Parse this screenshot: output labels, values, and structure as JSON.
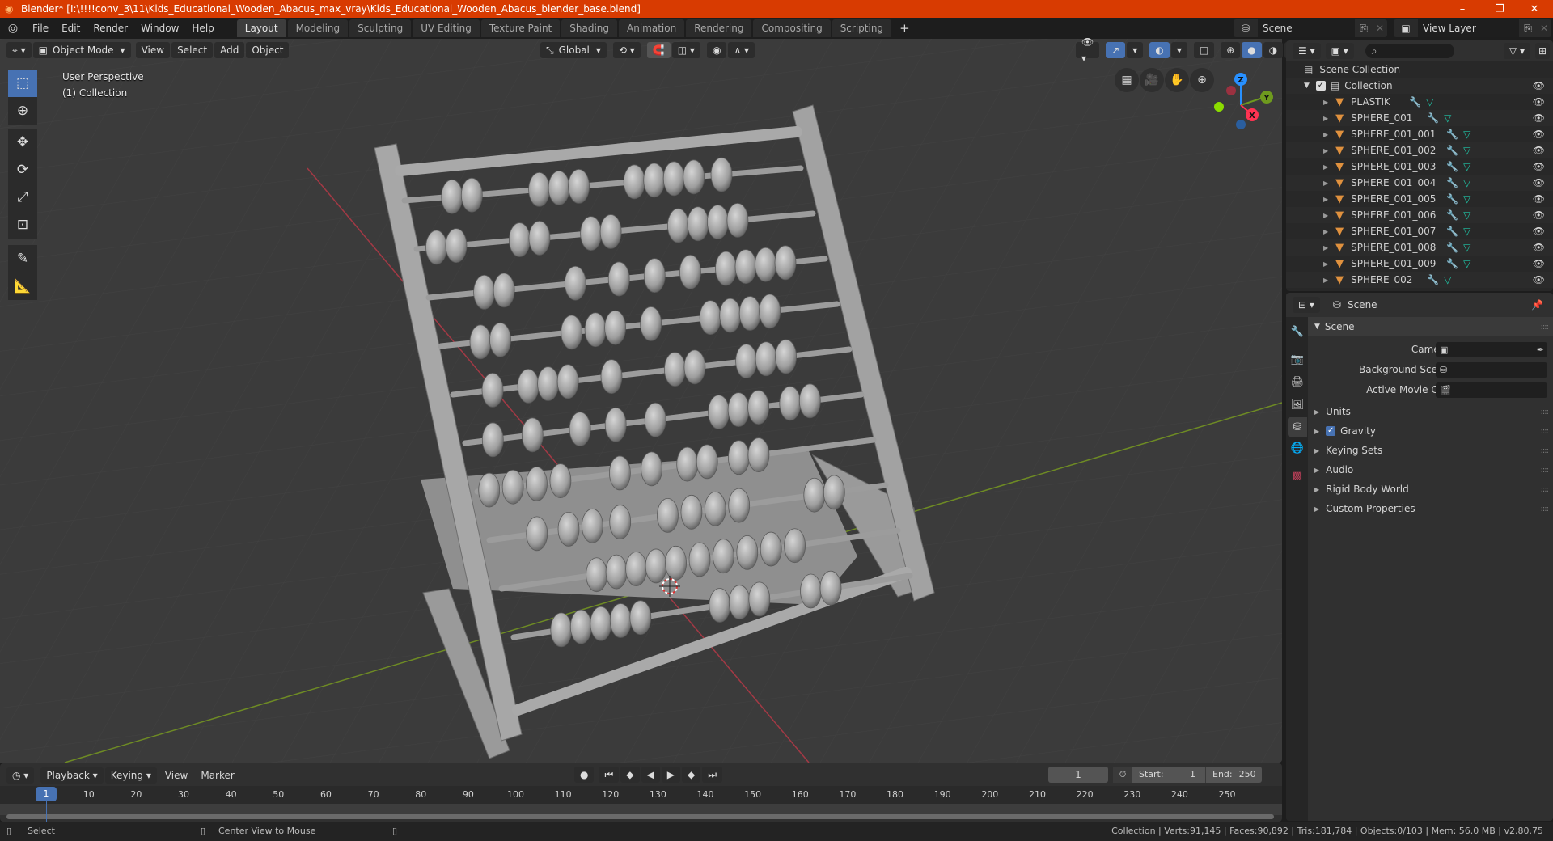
{
  "window": {
    "title": "Blender* [I:\\!!!!conv_3\\11\\Kids_Educational_Wooden_Abacus_max_vray\\Kids_Educational_Wooden_Abacus_blender_base.blend]",
    "controls": {
      "minimize": "–",
      "maximize": "❐",
      "close": "✕"
    }
  },
  "menubar": {
    "items": [
      "File",
      "Edit",
      "Render",
      "Window",
      "Help"
    ],
    "workspaces": [
      "Layout",
      "Modeling",
      "Sculpting",
      "UV Editing",
      "Texture Paint",
      "Shading",
      "Animation",
      "Rendering",
      "Compositing",
      "Scripting"
    ],
    "active_workspace": "Layout",
    "add_workspace": "+",
    "scene": "Scene",
    "view_layer": "View Layer"
  },
  "viewport": {
    "mode": "Object Mode",
    "menus": [
      "View",
      "Select",
      "Add",
      "Object"
    ],
    "orientation": "Global",
    "overlay_text": [
      "User Perspective",
      "(1) Collection"
    ],
    "gizmo_axes": {
      "z": "Z",
      "y": "Y",
      "x": "X"
    },
    "axis_colors": {
      "x": "#ff3352",
      "y": "#8bdc00",
      "z": "#2890ff"
    },
    "tools": [
      "select-box",
      "cursor",
      "move",
      "rotate",
      "scale",
      "transform",
      "annotate",
      "measure"
    ]
  },
  "outliner": {
    "root": "Scene Collection",
    "collection": "Collection",
    "objects": [
      "PLASTIK",
      "SPHERE_001",
      "SPHERE_001_001",
      "SPHERE_001_002",
      "SPHERE_001_003",
      "SPHERE_001_004",
      "SPHERE_001_005",
      "SPHERE_001_006",
      "SPHERE_001_007",
      "SPHERE_001_008",
      "SPHERE_001_009",
      "SPHERE_002"
    ]
  },
  "properties": {
    "context": "Scene",
    "panel_title": "Scene",
    "fields": [
      {
        "label": "Camera",
        "value": ""
      },
      {
        "label": "Background Scene",
        "value": ""
      },
      {
        "label": "Active Movie Clip",
        "value": ""
      }
    ],
    "sections": [
      "Units",
      "Gravity",
      "Keying Sets",
      "Audio",
      "Rigid Body World",
      "Custom Properties"
    ],
    "gravity_checked": true
  },
  "timeline": {
    "menus": [
      "Playback",
      "Keying",
      "View",
      "Marker"
    ],
    "current_frame": "1",
    "start_label": "Start:",
    "start": "1",
    "end_label": "End:",
    "end": "250",
    "ticks": [
      "10",
      "20",
      "30",
      "40",
      "50",
      "60",
      "70",
      "80",
      "90",
      "100",
      "110",
      "120",
      "130",
      "140",
      "150",
      "160",
      "170",
      "180",
      "190",
      "200",
      "210",
      "220",
      "230",
      "240",
      "250"
    ],
    "playhead": "1"
  },
  "statusbar": {
    "left_hint": "Select",
    "middle_hint": "Center View to Mouse",
    "stats": "Collection | Verts:91,145 | Faces:90,892 | Tris:181,784 | Objects:0/103 | Mem: 56.0 MB | v2.80.75"
  }
}
